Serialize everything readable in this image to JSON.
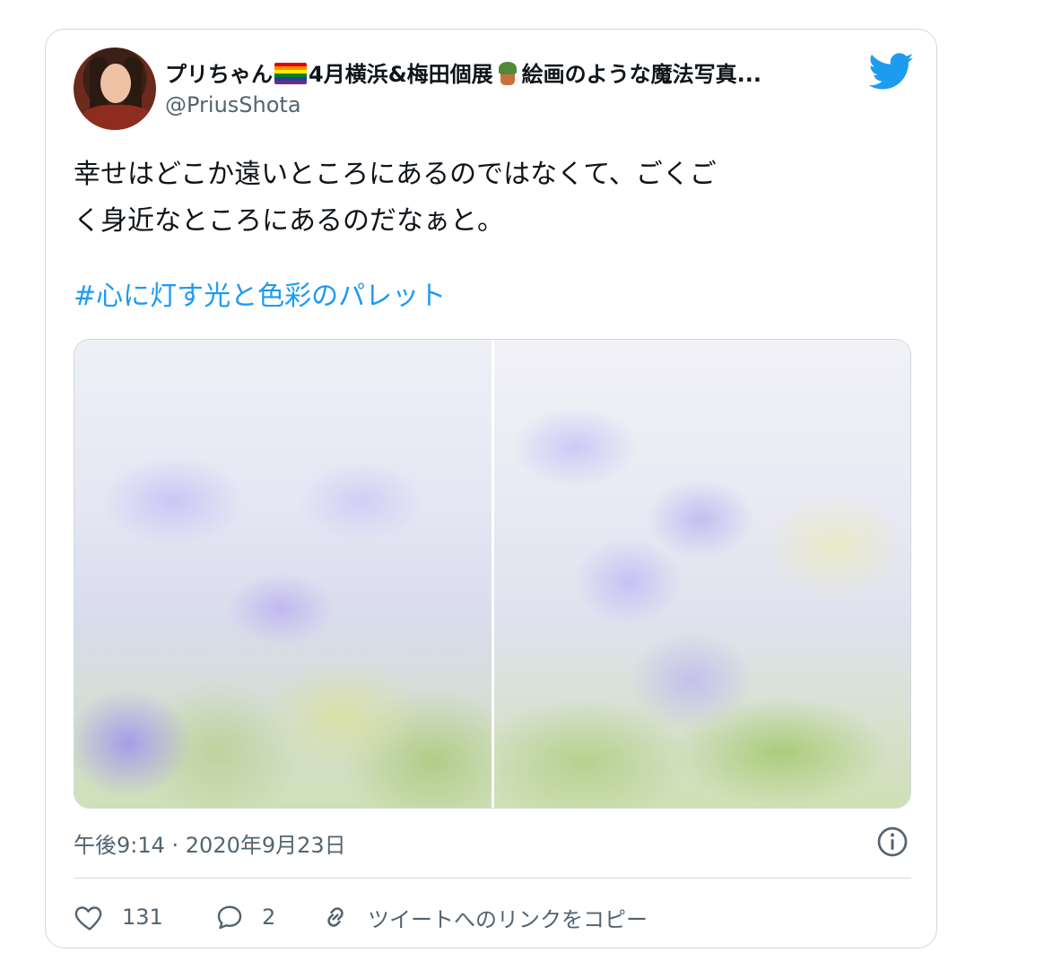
{
  "tweet": {
    "display_name": "プリちゃん",
    "display_name_mid": "4月横浜&梅田個展",
    "display_name_end": "絵画のような魔法写真...",
    "handle": "@PriusShota",
    "text_line1": "幸せはどこか遠いところにあるのではなくて、ごくご",
    "text_line2": "く身近なところにあるのだなぁと。",
    "hashtag": "#心に灯す光と色彩のパレット",
    "timestamp": "午後9:14 · 2020年9月23日",
    "likes": "131",
    "replies": "2",
    "copy_link": "ツイートへのリンクをコピー"
  },
  "icons": {
    "brand": "twitter-bird-icon",
    "info": "info-icon",
    "like": "heart-icon",
    "reply": "reply-bubble-icon",
    "link": "link-icon"
  },
  "colors": {
    "brand_blue": "#1d9bf0",
    "secondary_text": "#536471",
    "border": "#cfd9de"
  }
}
